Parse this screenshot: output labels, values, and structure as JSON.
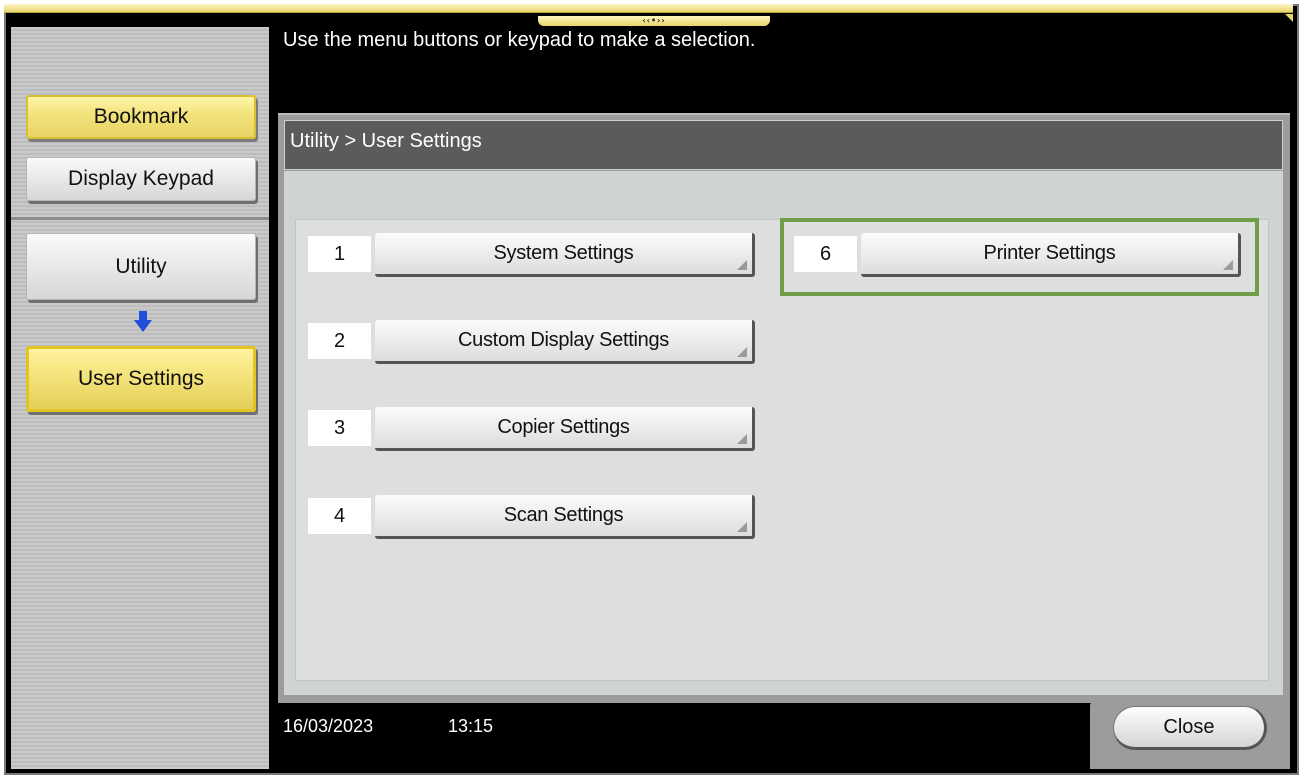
{
  "message": "Use the menu buttons or keypad to make a selection.",
  "sidebar": {
    "bookmark_label": "Bookmark",
    "display_keypad_label": "Display Keypad",
    "utility_label": "Utility",
    "user_settings_label": "User Settings"
  },
  "breadcrumb": "Utility > User Settings",
  "menu": {
    "items": [
      {
        "number": "1",
        "label": "System Settings"
      },
      {
        "number": "2",
        "label": "Custom Display Settings"
      },
      {
        "number": "3",
        "label": "Copier Settings"
      },
      {
        "number": "4",
        "label": "Scan Settings"
      },
      {
        "number": "6",
        "label": "Printer Settings"
      }
    ]
  },
  "footer": {
    "date": "16/03/2023",
    "time": "13:15",
    "close_label": "Close"
  },
  "colors": {
    "highlight": "#6e9e4a",
    "selected_yellow": "#f2e27b",
    "arrow_blue": "#1f4fd8"
  },
  "icons": {
    "down_arrow": "arrow-down-icon"
  }
}
